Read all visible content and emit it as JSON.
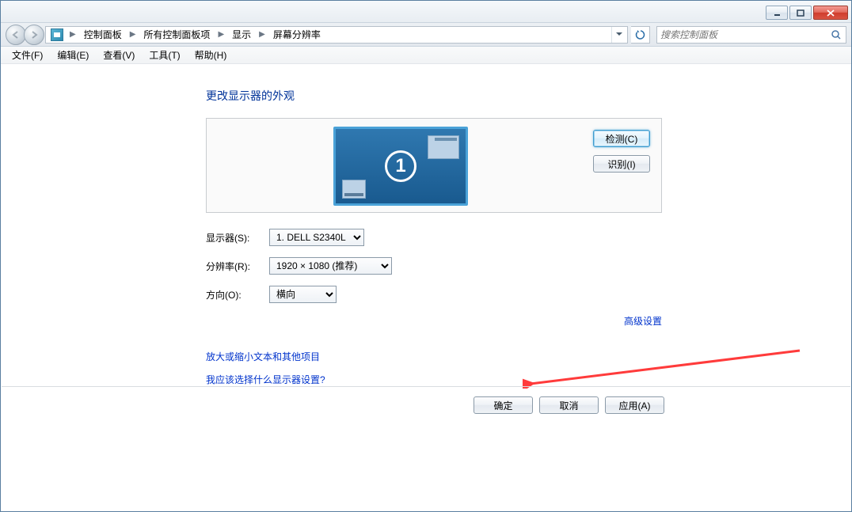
{
  "breadcrumb": {
    "items": [
      "控制面板",
      "所有控制面板项",
      "显示",
      "屏幕分辨率"
    ]
  },
  "search": {
    "placeholder": "搜索控制面板"
  },
  "menubar": {
    "file": "文件(F)",
    "edit": "编辑(E)",
    "view": "查看(V)",
    "tools": "工具(T)",
    "help": "帮助(H)"
  },
  "panel": {
    "title": "更改显示器的外观",
    "monitor_number": "1",
    "detect_btn": "检测(C)",
    "identify_btn": "识别(I)",
    "display_label": "显示器(S):",
    "display_value": "1. DELL S2340L",
    "resolution_label": "分辨率(R):",
    "resolution_value": "1920 × 1080 (推荐)",
    "orientation_label": "方向(O):",
    "orientation_value": "横向",
    "advanced_link": "高级设置",
    "zoom_link": "放大或缩小文本和其他项目",
    "which_link": "我应该选择什么显示器设置?"
  },
  "footer": {
    "ok": "确定",
    "cancel": "取消",
    "apply": "应用(A)"
  }
}
